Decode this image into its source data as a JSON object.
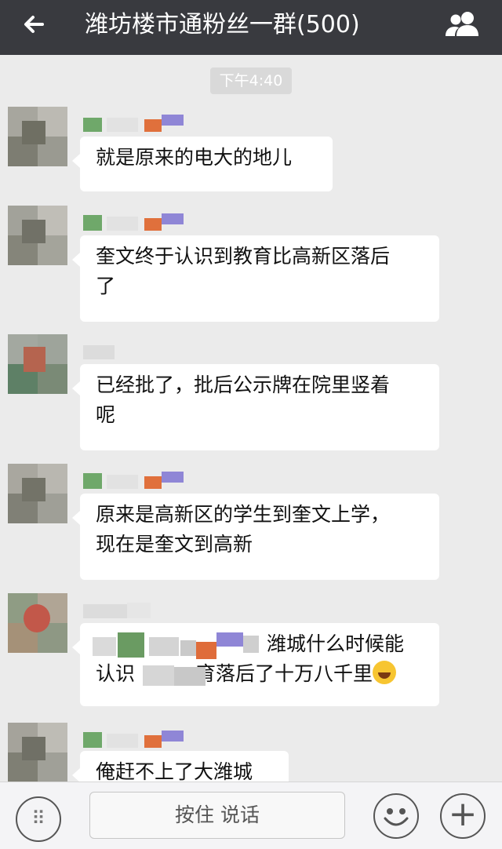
{
  "header": {
    "title": "潍坊楼市通粉丝一群(500)",
    "back_icon": "back-arrow-icon",
    "members_icon": "group-members-icon"
  },
  "timestamp": "下午4:40",
  "messages": [
    {
      "line1": "就是原来的电大的地儿",
      "line2": ""
    },
    {
      "line1": "奎文终于认识到教育比高新区落后",
      "line2": "了"
    },
    {
      "line1": "已经批了，批后公示牌在院里竖着",
      "line2": "呢"
    },
    {
      "line1": "原来是高新区的学生到奎文上学，",
      "line2": "现在是奎文到高新"
    },
    {
      "line1": "潍城什么时候能",
      "line2": "认识",
      "line2b": "育落后了十万八千里"
    },
    {
      "line1": "俺赶不上了大潍城",
      "line2": ""
    }
  ],
  "input": {
    "hold_to_talk": "按住 说话"
  },
  "colors": {
    "header_bg": "#393a3f",
    "chat_bg": "#ebebeb",
    "bubble_bg": "#ffffff"
  }
}
